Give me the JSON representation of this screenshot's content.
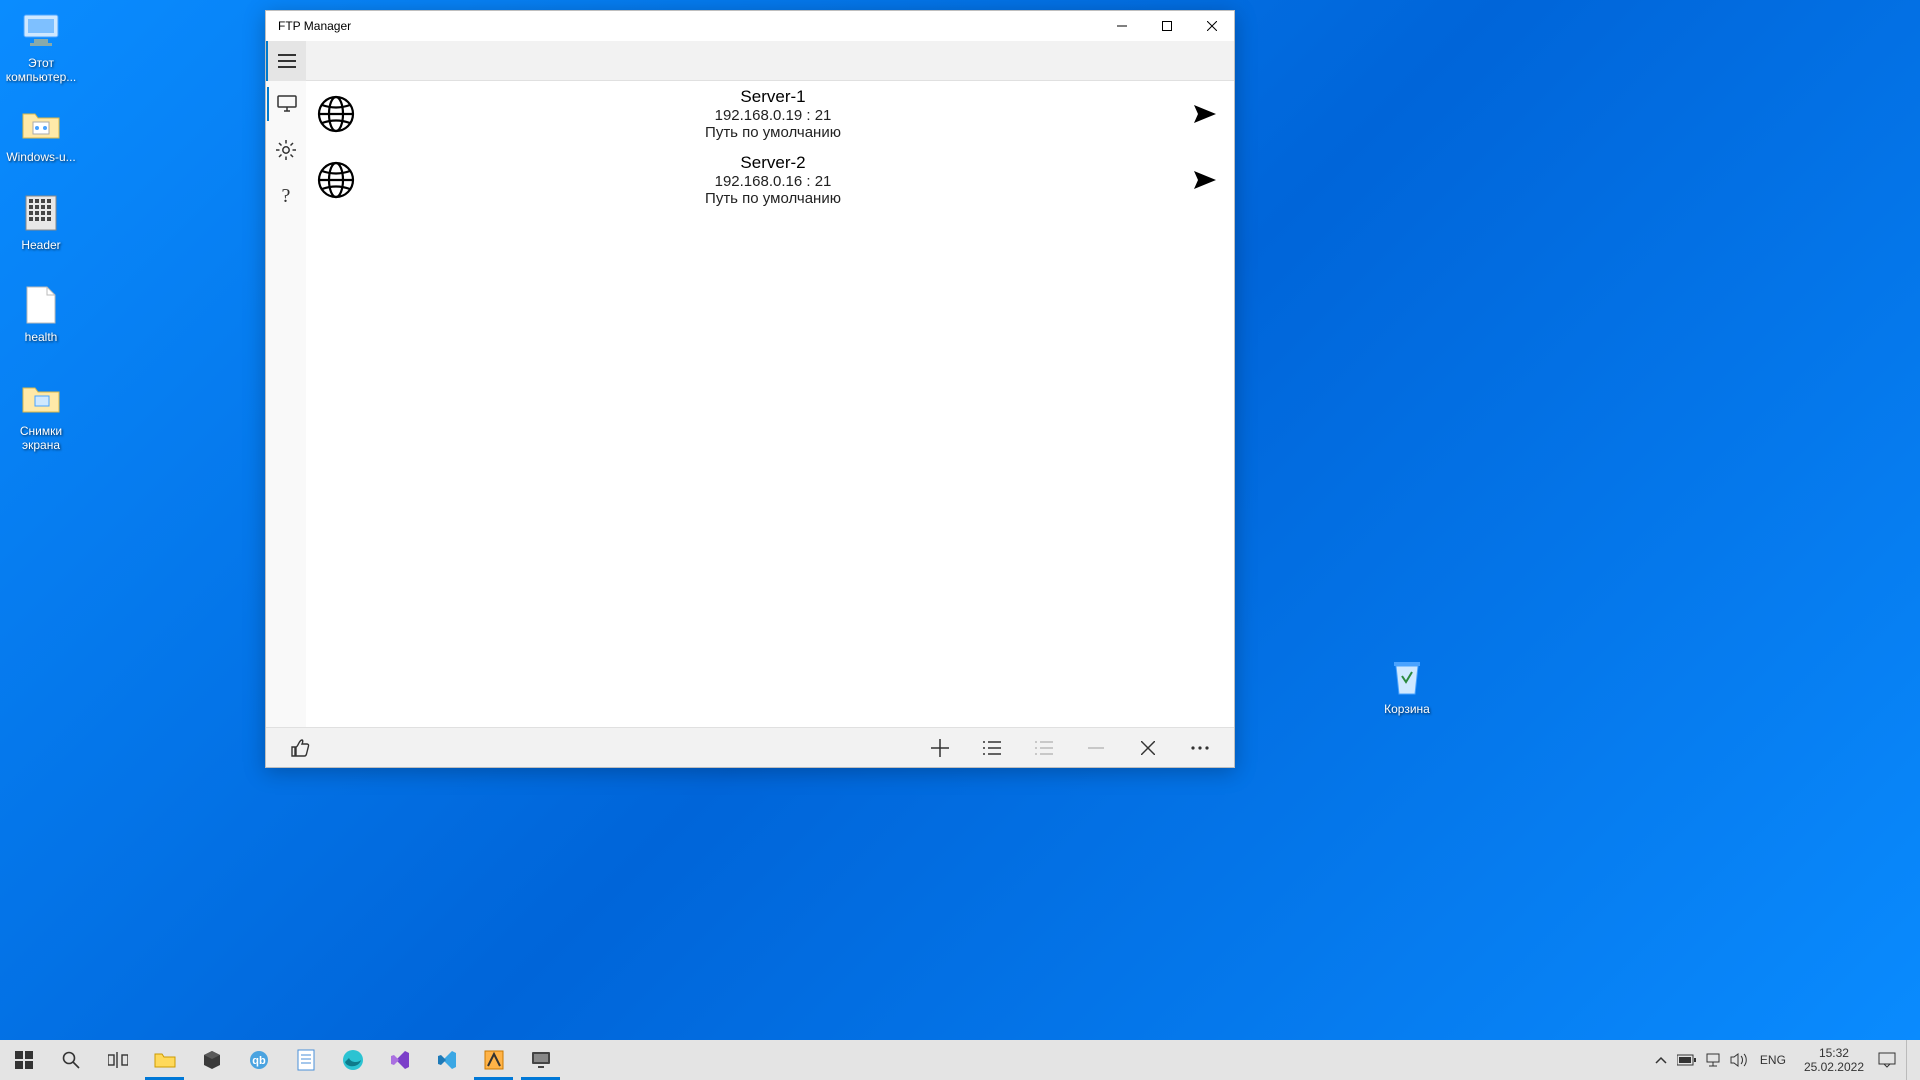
{
  "desktop_icons": {
    "this_pc": {
      "label": "Этот компьютер..."
    },
    "windows_u": {
      "label": "Windows-u..."
    },
    "header": {
      "label": "Header"
    },
    "health": {
      "label": "health"
    },
    "screenshots": {
      "label": "Снимки экрана"
    },
    "recycle_bin": {
      "label": "Корзина"
    }
  },
  "window": {
    "title": "FTP Manager",
    "servers": [
      {
        "name": "Server-1",
        "address": "192.168.0.19 : 21",
        "path": "Путь по умолчанию"
      },
      {
        "name": "Server-2",
        "address": "192.168.0.16 : 21",
        "path": "Путь по умолчанию"
      }
    ]
  },
  "systray": {
    "language": "ENG",
    "time": "15:32",
    "date": "25.02.2022"
  }
}
